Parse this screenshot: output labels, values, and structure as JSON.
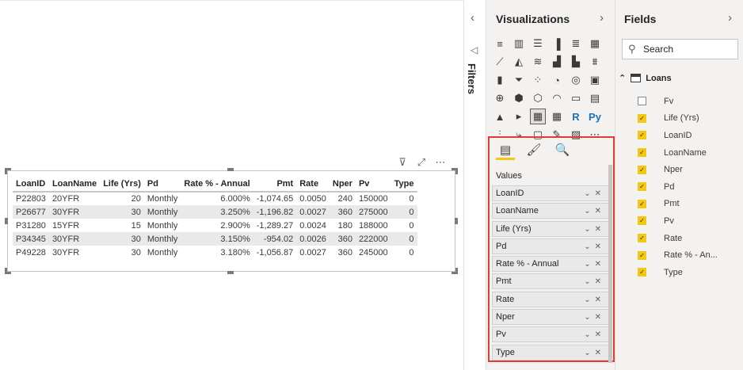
{
  "table": {
    "headers": [
      "LoanID",
      "LoanName",
      "Life (Yrs)",
      "Pd",
      "Rate % - Annual",
      "Pmt",
      "Rate",
      "Nper",
      "Pv",
      "Type"
    ],
    "rows": [
      [
        "P22803",
        "20YFR",
        "20",
        "Monthly",
        "6.000%",
        "-1,074.65",
        "0.0050",
        "240",
        "150000",
        "0"
      ],
      [
        "P26677",
        "30YFR",
        "30",
        "Monthly",
        "3.250%",
        "-1,196.82",
        "0.0027",
        "360",
        "275000",
        "0"
      ],
      [
        "P31280",
        "15YFR",
        "15",
        "Monthly",
        "2.900%",
        "-1,289.27",
        "0.0024",
        "180",
        "188000",
        "0"
      ],
      [
        "P34345",
        "30YFR",
        "30",
        "Monthly",
        "3.150%",
        "-954.02",
        "0.0026",
        "360",
        "222000",
        "0"
      ],
      [
        "P49228",
        "30YFR",
        "30",
        "Monthly",
        "3.180%",
        "-1,056.87",
        "0.0027",
        "360",
        "245000",
        "0"
      ]
    ]
  },
  "visual_header_icons": [
    "filter-icon",
    "focus-mode-icon",
    "more-options-icon"
  ],
  "filters": {
    "label": "Filters",
    "collapse_glyph": "‹"
  },
  "visualizations": {
    "title": "Visualizations",
    "collapse_glyph": "›",
    "icons": [
      "stacked-bar-icon",
      "stacked-column-icon",
      "clustered-bar-icon",
      "clustered-column-icon",
      "100-bar-icon",
      "100-column-icon",
      "line-chart-icon",
      "area-chart-icon",
      "stacked-area-icon",
      "line-column-icon",
      "line-clustered-icon",
      "ribbon-chart-icon",
      "waterfall-icon",
      "funnel-icon",
      "scatter-icon",
      "pie-chart-icon",
      "donut-chart-icon",
      "treemap-icon",
      "map-icon",
      "filled-map-icon",
      "shape-map-icon",
      "gauge-icon",
      "card-icon",
      "multirow-card-icon",
      "kpi-icon",
      "slicer-icon",
      "table-icon",
      "matrix-icon",
      "r-visual-icon",
      "python-visual-icon",
      "key-influencers-icon",
      "decomposition-tree-icon",
      "qa-icon",
      "smart-narrative-icon",
      "paginated-icon",
      "more-visuals-icon"
    ],
    "icon_glyphs": [
      "≡",
      "▥",
      "☰",
      "▐",
      "≣",
      "▦",
      "⟋",
      "◭",
      "≋",
      "▟",
      "▙",
      "⩩",
      "▮",
      "⏷",
      "⁘",
      "◔",
      "◎",
      "▣",
      "⊕",
      "⬢",
      "⬡",
      "◠",
      "▭",
      "▤",
      "▲",
      "▸",
      "▦",
      "▦",
      "R",
      "Py",
      "⫶",
      "⤷",
      "▢",
      "✎",
      "▨",
      "⋯"
    ],
    "selected_icon_index": 26,
    "well_tabs": [
      "fields-tab-icon",
      "format-tab-icon",
      "analytics-tab-icon"
    ],
    "well_tab_glyphs": [
      "▤",
      "🖌",
      "🔍"
    ],
    "values_label": "Values",
    "wells": [
      "LoanID",
      "LoanName",
      "Life (Yrs)",
      "Pd",
      "Rate % - Annual",
      "Pmt",
      "Rate",
      "Nper",
      "Pv",
      "Type"
    ],
    "well_controls": "⌄✕"
  },
  "fields": {
    "title": "Fields",
    "collapse_glyph": "›",
    "search_placeholder": "Search",
    "table_name": "Loans",
    "table_expand_glyph": "⌃",
    "items": [
      {
        "name": "Fv",
        "checked": false
      },
      {
        "name": "Life (Yrs)",
        "checked": true
      },
      {
        "name": "LoanID",
        "checked": true
      },
      {
        "name": "LoanName",
        "checked": true
      },
      {
        "name": "Nper",
        "checked": true
      },
      {
        "name": "Pd",
        "checked": true
      },
      {
        "name": "Pmt",
        "checked": true
      },
      {
        "name": "Pv",
        "checked": true
      },
      {
        "name": "Rate",
        "checked": true
      },
      {
        "name": "Rate % - An...",
        "checked": true
      },
      {
        "name": "Type",
        "checked": true
      }
    ]
  },
  "colors": {
    "accent": "#f2c811",
    "highlight_border": "#e03c31",
    "pane_bg": "#f3f2f1"
  }
}
